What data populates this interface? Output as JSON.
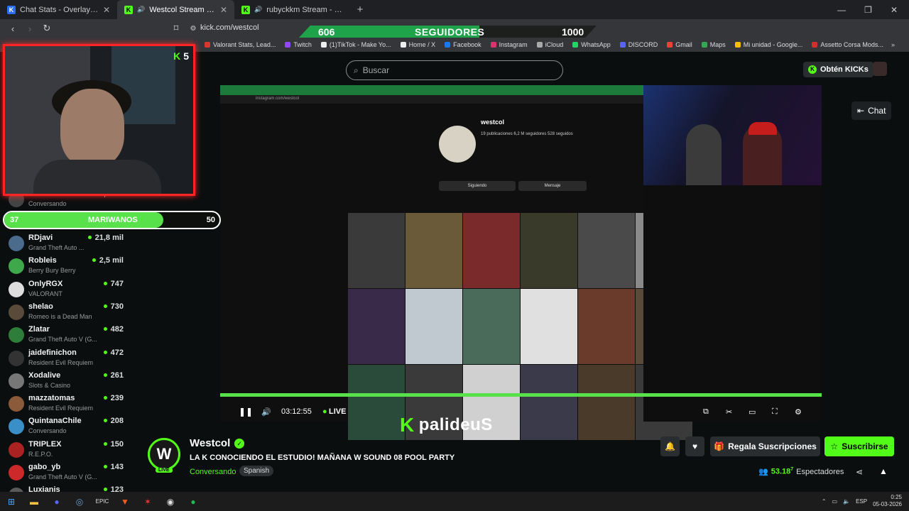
{
  "tabs": [
    {
      "title": "Chat Stats - Overlay - KickTools",
      "icon": "kt",
      "active": false
    },
    {
      "title": "Westcol Stream - Watch Live on Kick",
      "icon": "k",
      "active": true
    },
    {
      "title": "rubyckkm Stream - Watch Live on Kick",
      "icon": "k",
      "active": false
    }
  ],
  "address": "kick.com/westcol",
  "follow_bar": {
    "current": "606",
    "label": "SEGUIDORES",
    "goal": "1000",
    "progress": 0.606
  },
  "bookmarks": [
    {
      "label": "Valorant Stats, Lead...",
      "color": "#d9382f"
    },
    {
      "label": "Twitch",
      "color": "#9146ff"
    },
    {
      "label": "(1)TikTok - Make Yo...",
      "color": "#eeeeee"
    },
    {
      "label": "Home / X",
      "color": "#eeeeee"
    },
    {
      "label": "Facebook",
      "color": "#1877f2"
    },
    {
      "label": "Instagram",
      "color": "#e1306c"
    },
    {
      "label": "iCloud",
      "color": "#aaaaaa"
    },
    {
      "label": "WhatsApp",
      "color": "#25d366"
    },
    {
      "label": "DISCORD",
      "color": "#5865f2"
    },
    {
      "label": "Gmail",
      "color": "#ea4335"
    },
    {
      "label": "Maps",
      "color": "#34a853"
    },
    {
      "label": "Mi unidad - Google...",
      "color": "#fbbc04"
    },
    {
      "label": "Assetto Corsa Mods...",
      "color": "#d32f2f"
    }
  ],
  "search": {
    "placeholder": "Buscar"
  },
  "header": {
    "kicks_label": "Obtén KICKs"
  },
  "chat_button": "Chat",
  "webcam_badge": "5",
  "sidebar_partial": {
    "name": "Westcol",
    "viewers": "53,2 mil",
    "category": "Conversando"
  },
  "goal_bar": {
    "current": "37",
    "label": "MARIWANOS",
    "goal": "50",
    "progress": 0.74
  },
  "channels": [
    {
      "name": "RDjavi",
      "category": "Grand Theft Auto ...",
      "viewers": "21,8 mil",
      "color": "#4a6b8c"
    },
    {
      "name": "Robleis",
      "category": "Berry Bury Berry",
      "viewers": "2,5 mil",
      "color": "#3ea84a"
    },
    {
      "name": "OnlyRGX",
      "category": "VALORANT",
      "viewers": "747",
      "color": "#dddddd"
    },
    {
      "name": "shelao",
      "category": "Romeo is a Dead Man",
      "viewers": "730",
      "color": "#5a4a3a"
    },
    {
      "name": "Zlatar",
      "category": "Grand Theft Auto V (G...",
      "viewers": "482",
      "color": "#2f7d3a"
    },
    {
      "name": "jaidefinichon",
      "category": "Resident Evil Requiem",
      "viewers": "472",
      "color": "#333333"
    },
    {
      "name": "Xodalive",
      "category": "Slots & Casino",
      "viewers": "261",
      "color": "#777777"
    },
    {
      "name": "mazzatomas",
      "category": "Resident Evil Requiem",
      "viewers": "239",
      "color": "#8a5a3a"
    },
    {
      "name": "QuintanaChile",
      "category": "Conversando",
      "viewers": "208",
      "color": "#3a8fc9"
    },
    {
      "name": "TRIPLEX",
      "category": "R.E.P.O.",
      "viewers": "150",
      "color": "#aa2222"
    },
    {
      "name": "gabo_yb",
      "category": "Grand Theft Auto V (G...",
      "viewers": "143",
      "color": "#cc2a2a"
    },
    {
      "name": "Luxianis",
      "category": "",
      "viewers": "123",
      "color": "#5a5a5a"
    }
  ],
  "instagram": {
    "username": "westcol",
    "stats": "19 publicaciones   6,2 M seguidores   528 seguidos",
    "follow_btn": "Siguiendo",
    "message_btn": "Mensaje"
  },
  "grid_colors": [
    "#3a3a3a",
    "#6a5a3a",
    "#7a2a2a",
    "#3a3a2a",
    "#4a4a4a",
    "#8a8a8a",
    "#3a2a4a",
    "#c0c8d0",
    "#4a6a5a",
    "#e0e0e0",
    "#6a3a2a",
    "#5a4a3a",
    "#2a4a3a",
    "#3a3a3a",
    "#d0d0d0",
    "#3a3a4a",
    "#4a3a2a",
    "#3a3a3a"
  ],
  "player": {
    "time": "03:12:55",
    "live_label": "LIVE"
  },
  "overlay_name": "palideuS",
  "channel": {
    "name": "Westcol",
    "title": "LA K CONOCIENDO EL ESTUDIO! MAÑANA W SOUND 08 POOL PARTY",
    "category": "Conversando",
    "language": "Spanish",
    "live_badge": "LIVE",
    "logo_text": "W"
  },
  "actions": {
    "gift": "Regala Suscripciones",
    "subscribe": "Suscribirse"
  },
  "viewers": {
    "count": "53.18",
    "sup": "7",
    "label": "Espectadores"
  },
  "taskbar": {
    "lang": "ESP",
    "time": "0:25",
    "date": "05-03-2026"
  }
}
